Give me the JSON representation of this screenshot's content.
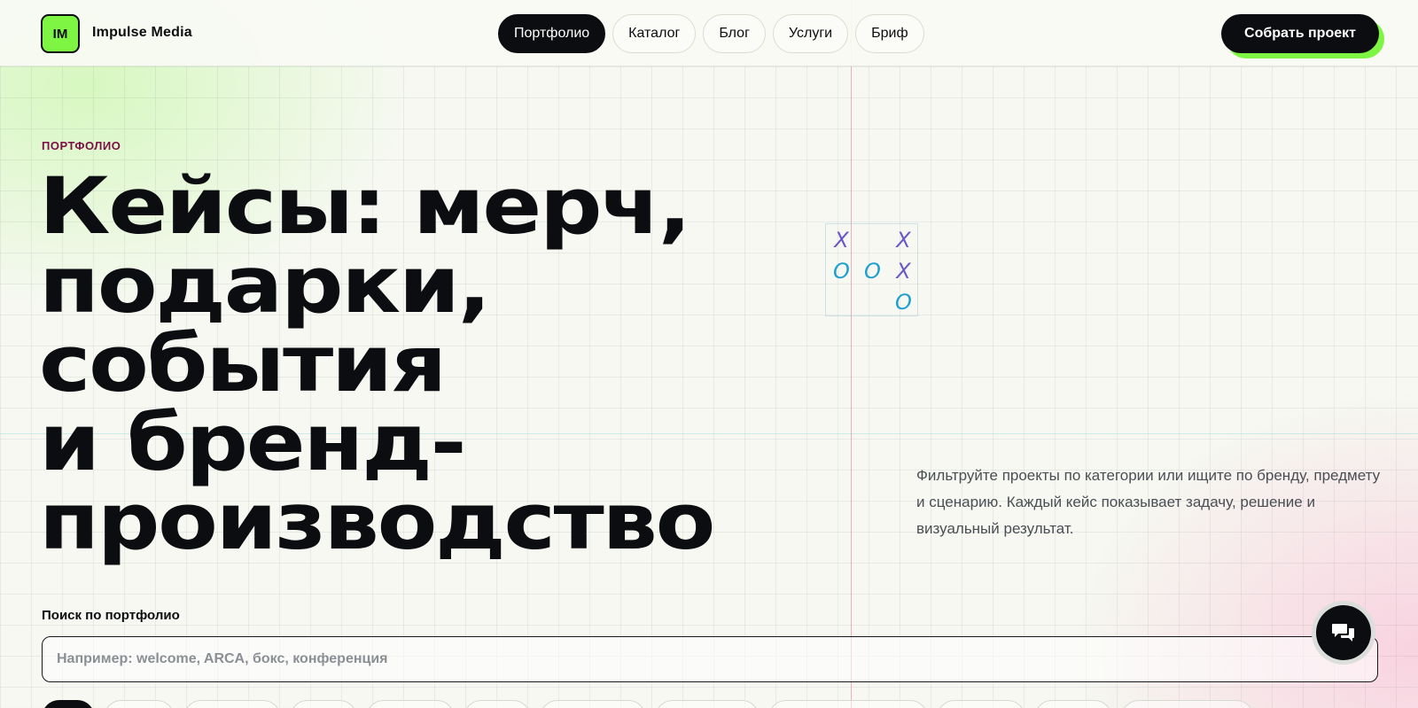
{
  "header": {
    "logo_mark": "IM",
    "brand_name": "Impulse Media",
    "nav": [
      {
        "label": "Портфолио",
        "active": true
      },
      {
        "label": "Каталог",
        "active": false
      },
      {
        "label": "Блог",
        "active": false
      },
      {
        "label": "Услуги",
        "active": false
      },
      {
        "label": "Бриф",
        "active": false
      }
    ],
    "cta_label": "Собрать проект"
  },
  "hero": {
    "eyebrow": "ПОРТФОЛИО",
    "title_lines": [
      "Кейсы: мерч,",
      "подарки,",
      "события",
      "и бренд-",
      "производство"
    ],
    "description": "Фильтруйте проекты по категории или ищите по бренду, предмету и сценарию. Каждый кейс показывает задачу, решение и визуальный результат."
  },
  "tic_tac_toe": {
    "cells": [
      "X",
      "",
      "X",
      "O",
      "O",
      "X",
      "",
      "",
      "O"
    ]
  },
  "search": {
    "label": "Поиск по портфолио",
    "placeholder": "Например: welcome, ARCA, бокс, конференция",
    "value": ""
  },
  "chat": {
    "icon": "chat-bubbles-icon"
  },
  "filters": {
    "active_index": 0
  },
  "colors": {
    "accent_green": "#7ef542",
    "dark": "#0c0d10",
    "eyebrow": "#7a1046",
    "x_mark": "#6b57c9",
    "o_mark": "#1e9fce"
  }
}
